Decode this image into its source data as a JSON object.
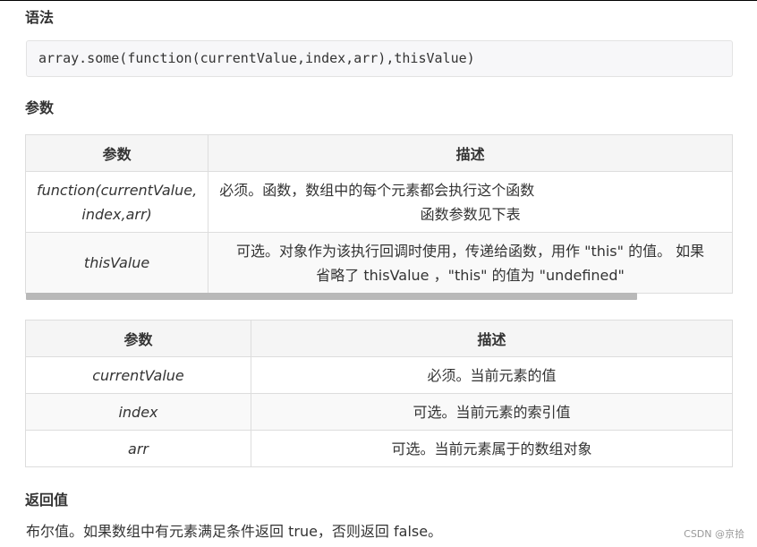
{
  "syntax": {
    "heading": "语法",
    "code": "array.some(function(currentValue,index,arr),thisValue)"
  },
  "params": {
    "heading": "参数",
    "table1": {
      "headers": [
        "参数",
        "描述"
      ],
      "rows": [
        {
          "param_line1": "function(currentValue,",
          "param_line2": "index,arr)",
          "desc_line1": "必须。函数，数组中的每个元素都会执行这个函数",
          "desc_line2": "函数参数见下表"
        },
        {
          "param": "thisValue",
          "desc_line1": "可选。对象作为该执行回调时使用，传递给函数，用作 \"this\" 的值。 如果",
          "desc_line2": "省略了 thisValue ，\"this\" 的值为 \"undefined\""
        }
      ]
    },
    "table2": {
      "headers": [
        "参数",
        "描述"
      ],
      "rows": [
        {
          "param": "currentValue",
          "desc": "必须。当前元素的值"
        },
        {
          "param": "index",
          "desc": "可选。当前元素的索引值"
        },
        {
          "param": "arr",
          "desc": "可选。当前元素属于的数组对象"
        }
      ]
    }
  },
  "returns": {
    "heading": "返回值",
    "text": "布尔值。如果数组中有元素满足条件返回 true，否则返回 false。"
  },
  "watermark": "CSDN @京拾"
}
